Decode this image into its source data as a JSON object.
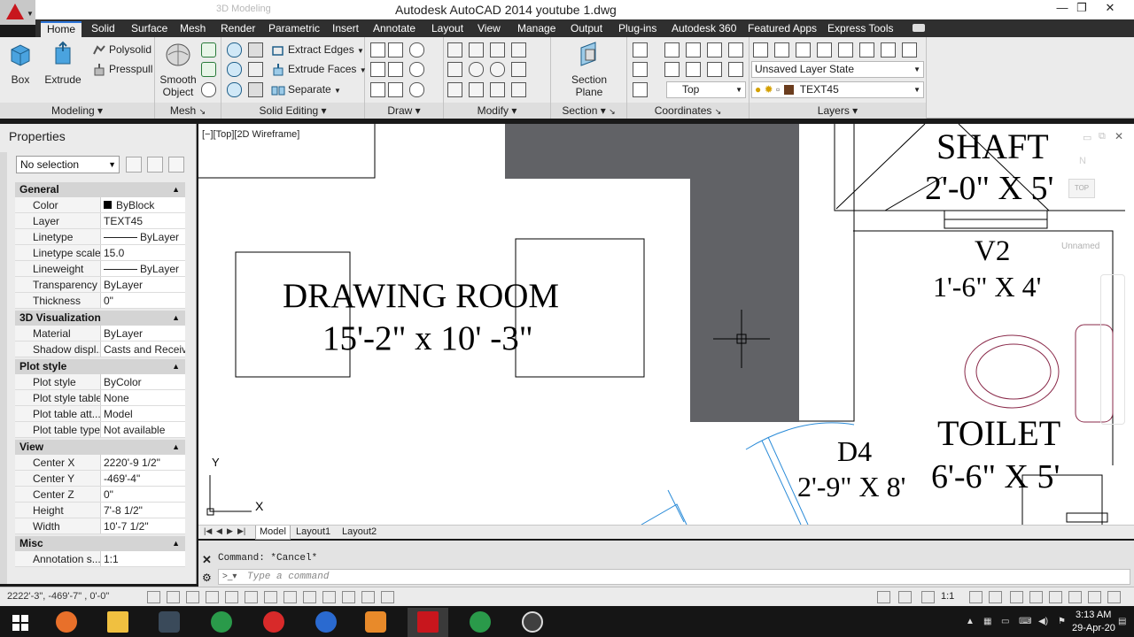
{
  "window": {
    "title": "Autodesk AutoCAD 2014    youtube 1.dwg",
    "workspace_label": "3D Modeling",
    "min": "—",
    "restore": "❐",
    "close": "✕"
  },
  "ribbon_tabs": [
    {
      "label": "Home",
      "active": true
    },
    {
      "label": "Solid"
    },
    {
      "label": "Surface"
    },
    {
      "label": "Mesh"
    },
    {
      "label": "Render"
    },
    {
      "label": "Parametric"
    },
    {
      "label": "Insert"
    },
    {
      "label": "Annotate"
    },
    {
      "label": "Layout"
    },
    {
      "label": "View"
    },
    {
      "label": "Manage"
    },
    {
      "label": "Output"
    },
    {
      "label": "Plug-ins"
    },
    {
      "label": "Autodesk 360"
    },
    {
      "label": "Featured Apps"
    },
    {
      "label": "Express Tools"
    }
  ],
  "ribbon": {
    "modeling": {
      "title": "Modeling",
      "box": "Box",
      "extrude": "Extrude",
      "polysolid": "Polysolid",
      "presspull": "Presspull"
    },
    "mesh": {
      "title": "Mesh",
      "smooth_1": "Smooth",
      "smooth_2": "Object"
    },
    "solid_editing": {
      "title": "Solid Editing",
      "extract_edges": "Extract Edges",
      "extrude_faces": "Extrude Faces",
      "separate": "Separate"
    },
    "draw": {
      "title": "Draw"
    },
    "modify": {
      "title": "Modify"
    },
    "section": {
      "title": "Section",
      "plane_1": "Section",
      "plane_2": "Plane"
    },
    "coordinates": {
      "title": "Coordinates",
      "view_value": "Top"
    },
    "layers": {
      "title": "Layers",
      "layer_state": "Unsaved Layer State",
      "current_layer": "TEXT45"
    }
  },
  "properties": {
    "title": "Properties",
    "selection": "No selection",
    "sections": [
      {
        "name": "General",
        "rows": [
          {
            "k": "Color",
            "v": "ByBlock"
          },
          {
            "k": "Layer",
            "v": "TEXT45"
          },
          {
            "k": "Linetype",
            "v": "ByLayer"
          },
          {
            "k": "Linetype scale",
            "v": "15.0"
          },
          {
            "k": "Lineweight",
            "v": "ByLayer"
          },
          {
            "k": "Transparency",
            "v": "ByLayer"
          },
          {
            "k": "Thickness",
            "v": "0\""
          }
        ]
      },
      {
        "name": "3D Visualization",
        "rows": [
          {
            "k": "Material",
            "v": "ByLayer"
          },
          {
            "k": "Shadow displ...",
            "v": "Casts and Receiv..."
          }
        ]
      },
      {
        "name": "Plot style",
        "rows": [
          {
            "k": "Plot style",
            "v": "ByColor"
          },
          {
            "k": "Plot style table",
            "v": "None"
          },
          {
            "k": "Plot table att...",
            "v": "Model"
          },
          {
            "k": "Plot table type",
            "v": "Not available"
          }
        ]
      },
      {
        "name": "View",
        "rows": [
          {
            "k": "Center X",
            "v": "2220'-9 1/2\""
          },
          {
            "k": "Center Y",
            "v": "-469'-4\""
          },
          {
            "k": "Center Z",
            "v": "0\""
          },
          {
            "k": "Height",
            "v": "7'-8 1/2\""
          },
          {
            "k": "Width",
            "v": "10'-7 1/2\""
          }
        ]
      },
      {
        "name": "Misc",
        "rows": [
          {
            "k": "Annotation s...",
            "v": "1:1"
          }
        ]
      }
    ]
  },
  "viewport": {
    "label": "[−][Top][2D Wireframe]",
    "texts": {
      "shaft_title": "SHAFT",
      "shaft_dim": "2'-0\" X 5'",
      "v2_title": "V2",
      "v2_dim": "1'-6\" X 4'",
      "drawing_room_title": "DRAWING ROOM",
      "drawing_room_dim": "15'-2\" x 10' -3\"",
      "toilet_title": "TOILET",
      "toilet_dim": "6'-6\" X 5'",
      "d4_title": "D4",
      "d4_dim": "2'-9\" X 8'"
    },
    "ucs_y": "Y",
    "ucs_x": "X",
    "viewcube_n": "N",
    "viewcube_top": "TOP",
    "ucs_name": "Unnamed"
  },
  "layout_tabs": {
    "model": "Model",
    "layout1": "Layout1",
    "layout2": "Layout2"
  },
  "command": {
    "history": "Command: *Cancel*",
    "placeholder": "Type a command"
  },
  "status": {
    "coords": "2222'-3\", -469'-7\" , 0'-0\"",
    "scale": "1:1"
  },
  "taskbar": {
    "time": "3:13 AM",
    "date": "29-Apr-20"
  }
}
